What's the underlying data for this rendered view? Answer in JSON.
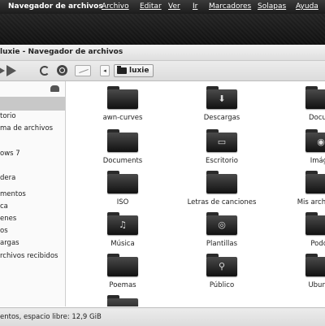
{
  "topbar": {
    "app_name": "Navegador de archivos",
    "menu": [
      "Archivo",
      "Editar",
      "Ver",
      "Ir",
      "Marcadores",
      "Solapas",
      "Ayuda"
    ]
  },
  "window": {
    "title": "luxie - Navegador de archivos"
  },
  "toolbar": {
    "breadcrumb": "luxie"
  },
  "sidebar": {
    "items": [
      "torio",
      "ma de archivos",
      "ows 7",
      "dera",
      "mentos",
      "ca",
      "enes",
      "os",
      "argas",
      "rchivos recibidos"
    ]
  },
  "files": [
    {
      "name": "awn-curves",
      "icon": "plain-folder-icon",
      "emblem": ""
    },
    {
      "name": "Descargas",
      "icon": "download-folder-icon",
      "emblem": "⬇"
    },
    {
      "name": "Docum",
      "icon": "plain-folder-icon",
      "emblem": ""
    },
    {
      "name": "Documents",
      "icon": "plain-folder-icon",
      "emblem": ""
    },
    {
      "name": "Escritorio",
      "icon": "desktop-folder-icon",
      "emblem": "▭"
    },
    {
      "name": "Imáge",
      "icon": "camera-folder-icon",
      "emblem": "◉"
    },
    {
      "name": "ISO",
      "icon": "plain-folder-icon",
      "emblem": ""
    },
    {
      "name": "Letras de canciones",
      "icon": "plain-folder-icon",
      "emblem": ""
    },
    {
      "name": "Mis archivos r",
      "icon": "plain-folder-icon",
      "emblem": ""
    },
    {
      "name": "Música",
      "icon": "music-folder-icon",
      "emblem": "♫"
    },
    {
      "name": "Plantillas",
      "icon": "templates-folder-icon",
      "emblem": "◎"
    },
    {
      "name": "Podca",
      "icon": "plain-folder-icon",
      "emblem": ""
    },
    {
      "name": "Poemas",
      "icon": "plain-folder-icon",
      "emblem": ""
    },
    {
      "name": "Público",
      "icon": "public-folder-icon",
      "emblem": "⚲"
    },
    {
      "name": "Ubuntu",
      "icon": "plain-folder-icon",
      "emblem": ""
    },
    {
      "name": "",
      "icon": "network-folder-icon",
      "emblem": "☁"
    }
  ],
  "status": {
    "text": "entos, espacio libre: 12,9 GiB"
  }
}
